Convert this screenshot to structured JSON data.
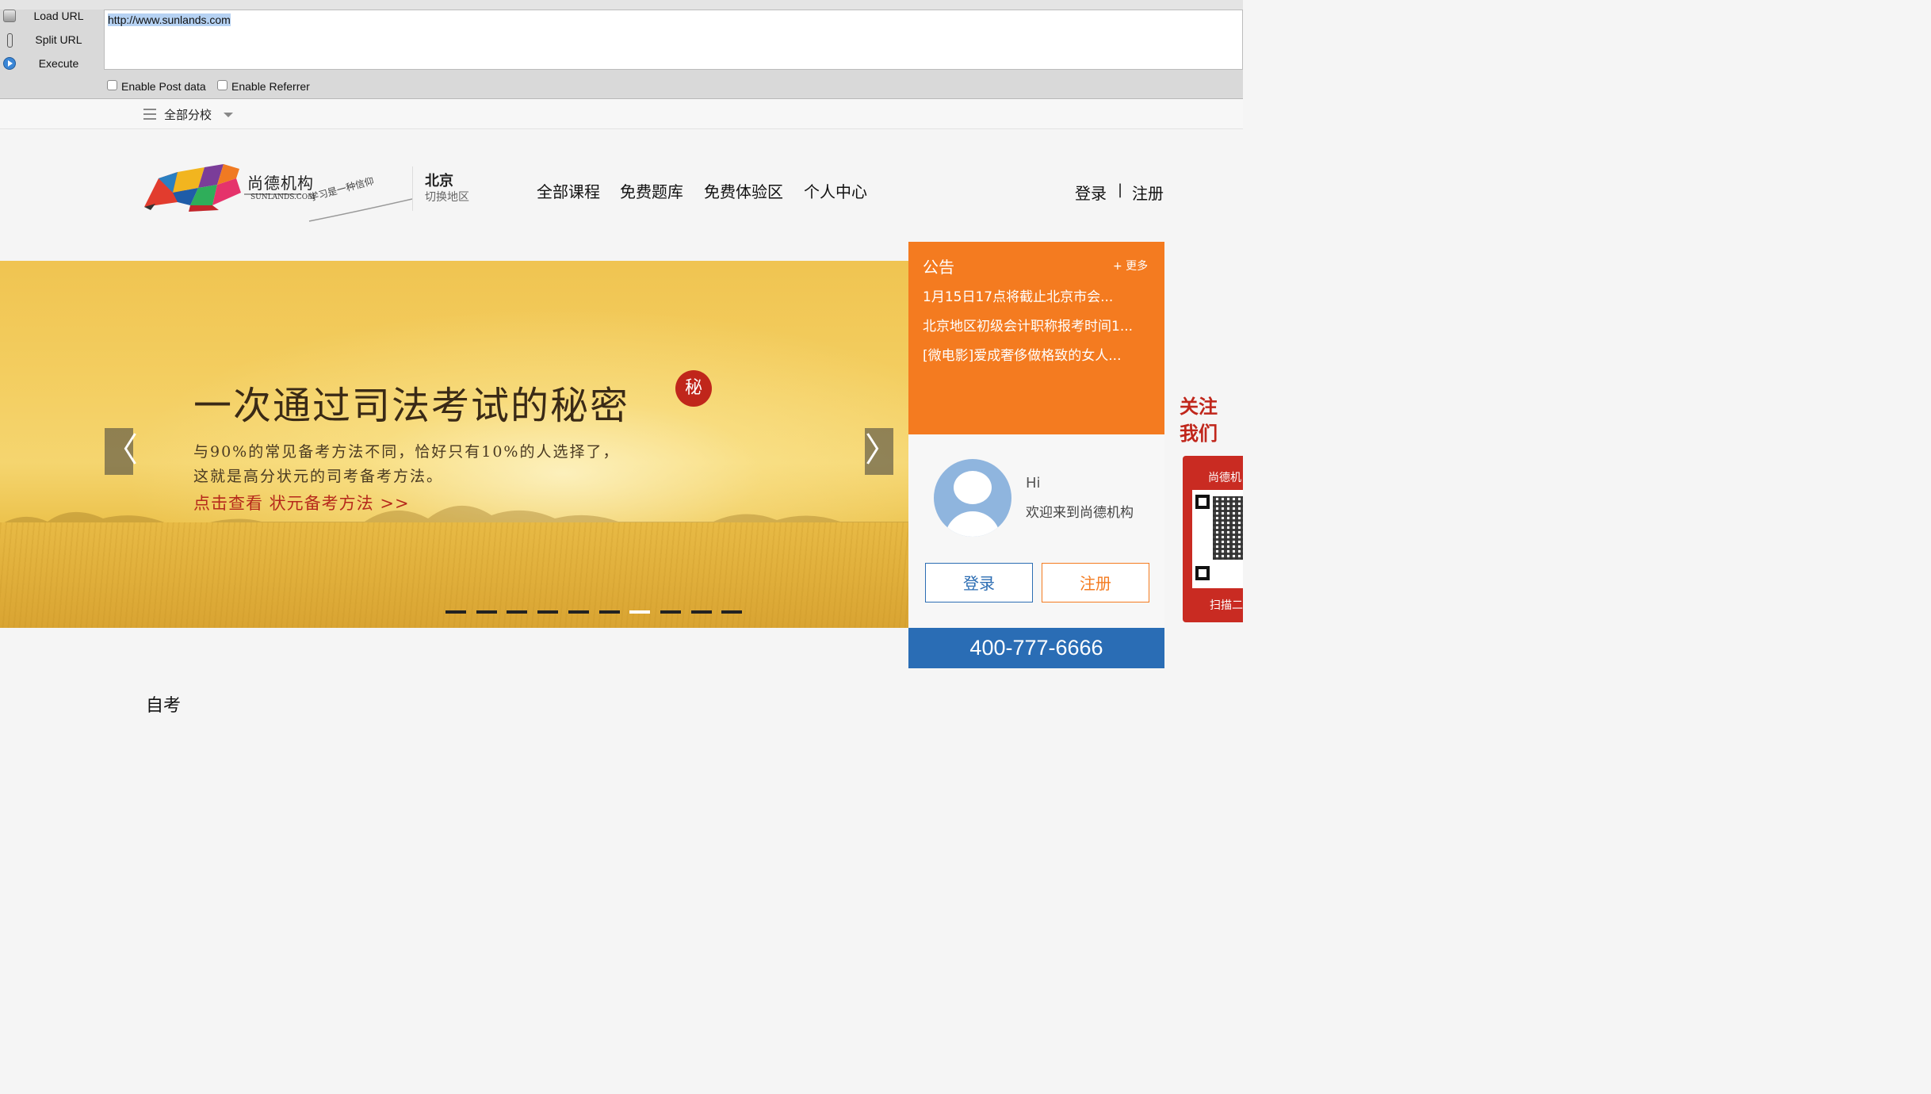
{
  "toolbar": {
    "load_url": "Load URL",
    "split_url": "Split URL",
    "execute": "Execute",
    "url_value": "http://www.sunlands.com",
    "enable_post": "Enable Post data",
    "enable_referrer": "Enable Referrer"
  },
  "branch": {
    "label": "全部分校"
  },
  "header": {
    "logo_name": "尚德机构",
    "logo_domain": "SUNLANDS.COM",
    "logo_slogan": "学习是一种信仰",
    "city": "北京",
    "city_switch": "切换地区",
    "nav": [
      "全部课程",
      "免费题库",
      "免费体验区",
      "个人中心"
    ],
    "login": "登录",
    "separator": "|",
    "register": "注册"
  },
  "banner": {
    "headline": "一次通过司法考试的秘密",
    "seal": "秘",
    "line1": "与90%的常见备考方法不同，恰好只有10%的人选择了，",
    "line2": "这就是高分状元的司考备考方法。",
    "cta": "点击查看 状元备考方法 >>",
    "prev": "〈",
    "next": "〉",
    "slide_count": 10,
    "active_slide": 7
  },
  "notice": {
    "title": "公告",
    "more": "+ 更多",
    "items": [
      "1月15日17点将截止北京市会...",
      "北京地区初级会计职称报考时间1...",
      "[微电影]爱成奢侈做格致的女人..."
    ]
  },
  "user_panel": {
    "hi": "Hi",
    "welcome": "欢迎来到尚德机构",
    "login": "登录",
    "register": "注册"
  },
  "hotline": "400-777-6666",
  "follow": {
    "title_line1": "关注",
    "title_line2": "我们",
    "brand": "尚德机",
    "caption": "扫描二"
  },
  "section": {
    "heading": "自考"
  },
  "colors": {
    "orange": "#f47b20",
    "blue": "#2a6db5",
    "red": "#c0261b"
  }
}
